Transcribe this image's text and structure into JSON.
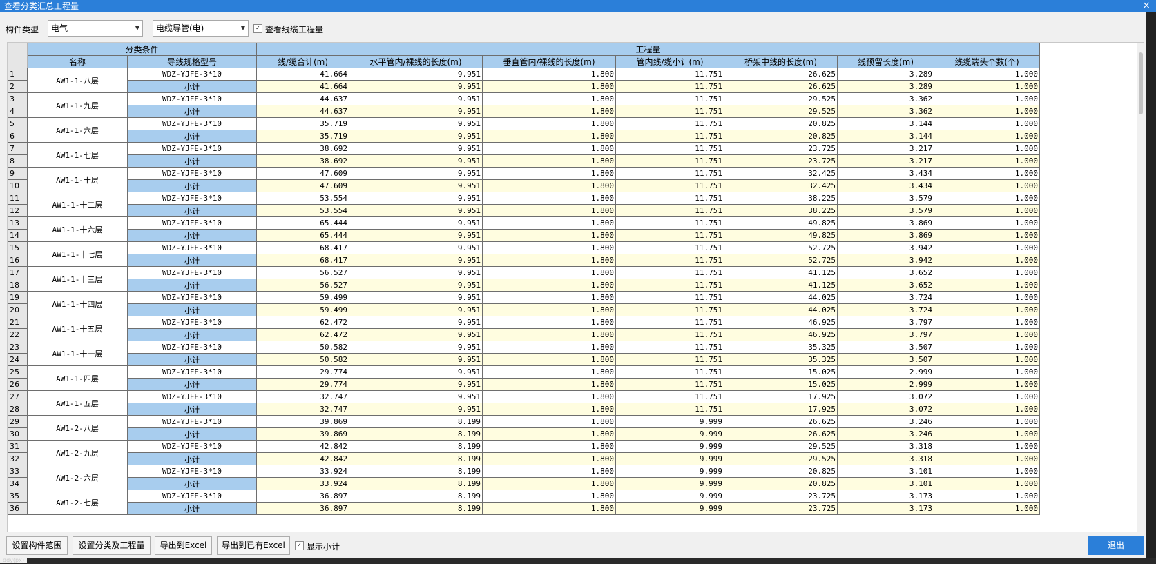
{
  "window": {
    "title": "查看分类汇总工程量",
    "close_glyph": "×"
  },
  "filters": {
    "type_label": "构件类型",
    "type_value": "电气",
    "subtype_value": "电缆导管(电)",
    "view_cable_label": "查看线缆工程量",
    "view_cable_checked": true
  },
  "table": {
    "group_headers": [
      "分类条件",
      "工程量"
    ],
    "columns": [
      "名称",
      "导线规格型号",
      "线/缆合计(m)",
      "水平管内/裸线的长度(m)",
      "垂直管内/裸线的长度(m)",
      "管内线/缆小计(m)",
      "桥架中线的长度(m)",
      "线预留长度(m)",
      "线缆端头个数(个)"
    ],
    "subtotal_label": "小计",
    "groups": [
      {
        "name": "AW1-1-八层",
        "spec": "WDZ-YJFE-3*10",
        "values": [
          "41.664",
          "9.951",
          "1.800",
          "11.751",
          "26.625",
          "3.289",
          "1.000"
        ]
      },
      {
        "name": "AW1-1-九层",
        "spec": "WDZ-YJFE-3*10",
        "values": [
          "44.637",
          "9.951",
          "1.800",
          "11.751",
          "29.525",
          "3.362",
          "1.000"
        ]
      },
      {
        "name": "AW1-1-六层",
        "spec": "WDZ-YJFE-3*10",
        "values": [
          "35.719",
          "9.951",
          "1.800",
          "11.751",
          "20.825",
          "3.144",
          "1.000"
        ]
      },
      {
        "name": "AW1-1-七层",
        "spec": "WDZ-YJFE-3*10",
        "values": [
          "38.692",
          "9.951",
          "1.800",
          "11.751",
          "23.725",
          "3.217",
          "1.000"
        ]
      },
      {
        "name": "AW1-1-十层",
        "spec": "WDZ-YJFE-3*10",
        "values": [
          "47.609",
          "9.951",
          "1.800",
          "11.751",
          "32.425",
          "3.434",
          "1.000"
        ]
      },
      {
        "name": "AW1-1-十二层",
        "spec": "WDZ-YJFE-3*10",
        "values": [
          "53.554",
          "9.951",
          "1.800",
          "11.751",
          "38.225",
          "3.579",
          "1.000"
        ]
      },
      {
        "name": "AW1-1-十六层",
        "spec": "WDZ-YJFE-3*10",
        "values": [
          "65.444",
          "9.951",
          "1.800",
          "11.751",
          "49.825",
          "3.869",
          "1.000"
        ]
      },
      {
        "name": "AW1-1-十七层",
        "spec": "WDZ-YJFE-3*10",
        "values": [
          "68.417",
          "9.951",
          "1.800",
          "11.751",
          "52.725",
          "3.942",
          "1.000"
        ]
      },
      {
        "name": "AW1-1-十三层",
        "spec": "WDZ-YJFE-3*10",
        "values": [
          "56.527",
          "9.951",
          "1.800",
          "11.751",
          "41.125",
          "3.652",
          "1.000"
        ]
      },
      {
        "name": "AW1-1-十四层",
        "spec": "WDZ-YJFE-3*10",
        "values": [
          "59.499",
          "9.951",
          "1.800",
          "11.751",
          "44.025",
          "3.724",
          "1.000"
        ]
      },
      {
        "name": "AW1-1-十五层",
        "spec": "WDZ-YJFE-3*10",
        "values": [
          "62.472",
          "9.951",
          "1.800",
          "11.751",
          "46.925",
          "3.797",
          "1.000"
        ]
      },
      {
        "name": "AW1-1-十一层",
        "spec": "WDZ-YJFE-3*10",
        "values": [
          "50.582",
          "9.951",
          "1.800",
          "11.751",
          "35.325",
          "3.507",
          "1.000"
        ]
      },
      {
        "name": "AW1-1-四层",
        "spec": "WDZ-YJFE-3*10",
        "values": [
          "29.774",
          "9.951",
          "1.800",
          "11.751",
          "15.025",
          "2.999",
          "1.000"
        ]
      },
      {
        "name": "AW1-1-五层",
        "spec": "WDZ-YJFE-3*10",
        "values": [
          "32.747",
          "9.951",
          "1.800",
          "11.751",
          "17.925",
          "3.072",
          "1.000"
        ]
      },
      {
        "name": "AW1-2-八层",
        "spec": "WDZ-YJFE-3*10",
        "values": [
          "39.869",
          "8.199",
          "1.800",
          "9.999",
          "26.625",
          "3.246",
          "1.000"
        ]
      },
      {
        "name": "AW1-2-九层",
        "spec": "WDZ-YJFE-3*10",
        "values": [
          "42.842",
          "8.199",
          "1.800",
          "9.999",
          "29.525",
          "3.318",
          "1.000"
        ]
      },
      {
        "name": "AW1-2-六层",
        "spec": "WDZ-YJFE-3*10",
        "values": [
          "33.924",
          "8.199",
          "1.800",
          "9.999",
          "20.825",
          "3.101",
          "1.000"
        ]
      },
      {
        "name": "AW1-2-七层",
        "spec": "WDZ-YJFE-3*10",
        "values": [
          "36.897",
          "8.199",
          "1.800",
          "9.999",
          "23.725",
          "3.173",
          "1.000"
        ]
      }
    ]
  },
  "bottom": {
    "set_range": "设置构件范围",
    "set_category": "设置分类及工程量",
    "export_excel": "导出到Excel",
    "export_existing": "导出到已有Excel",
    "show_subtotal_label": "显示小计",
    "show_subtotal_checked": true,
    "exit": "退出"
  },
  "status": {
    "text": "ddy(px)"
  }
}
